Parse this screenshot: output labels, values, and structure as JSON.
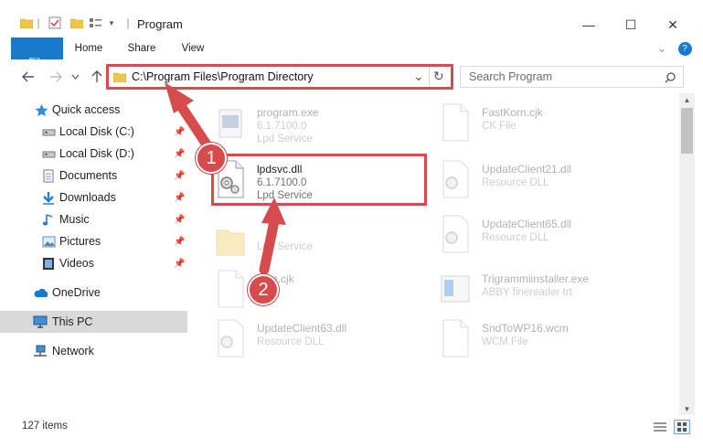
{
  "window": {
    "title": "Program",
    "minimize_glyph": "—",
    "maximize_glyph": "☐",
    "close_glyph": "✕"
  },
  "ribbon": {
    "tabs": [
      "File",
      "Home",
      "Share",
      "View"
    ],
    "expand_glyph": "⌄",
    "help_glyph": "?"
  },
  "address_bar": {
    "path": "C:\\Program Files\\Program Directory",
    "dropdown_glyph": "⌄",
    "refresh_glyph": "↻"
  },
  "search": {
    "placeholder": "Search Program",
    "icon": "search-icon"
  },
  "sidebar": {
    "quick_access": "Quick access",
    "items": [
      {
        "label": "Local Disk (C:)",
        "icon": "drive-icon",
        "pinned": true
      },
      {
        "label": "Local Disk (D:)",
        "icon": "drive-icon",
        "pinned": true
      },
      {
        "label": "Documents",
        "icon": "documents-icon",
        "pinned": true
      },
      {
        "label": "Downloads",
        "icon": "download-icon",
        "pinned": true
      },
      {
        "label": "Music",
        "icon": "music-icon",
        "pinned": true
      },
      {
        "label": "Pictures",
        "icon": "pictures-icon",
        "pinned": true
      },
      {
        "label": "Videos",
        "icon": "videos-icon",
        "pinned": true
      }
    ],
    "onedrive": "OneDrive",
    "this_pc": "This PC",
    "network": "Network"
  },
  "files": {
    "left": [
      {
        "name": "program.exe",
        "line1": "6.1.7100.0",
        "line2": "Lpd Service",
        "faded": true
      },
      {
        "name": "lpdsvc.dll",
        "line1": "6.1.7100.0",
        "line2": "Lpd Service",
        "faded": false,
        "highlighted": true
      },
      {
        "name": "",
        "line1": "",
        "line2": "Lpd Service",
        "faded": true
      },
      {
        "name": "lean.cjk",
        "line1": "",
        "line2": "",
        "faded": true
      },
      {
        "name": "UpdateClient63.dll",
        "line1": "Resource DLL",
        "line2": "",
        "faded": true
      }
    ],
    "right": [
      {
        "name": "FastKorn.cjk",
        "line1": "CK File",
        "faded": true
      },
      {
        "name": "UpdateClient21.dll",
        "line1": "Resource DLL",
        "faded": true
      },
      {
        "name": "UpdateClient65.dll",
        "line1": "Resource DLL",
        "faded": true
      },
      {
        "name": "Trigrammiinstaller.exe",
        "line1": "ABBY finereader trt",
        "faded": true
      },
      {
        "name": "SndToWP16.wcm",
        "line1": "WCM File",
        "faded": true
      }
    ]
  },
  "status": {
    "item_count": "127 items"
  },
  "callouts": [
    "1",
    "2"
  ],
  "colors": {
    "accent": "#1979ca",
    "highlight": "#d64b4b",
    "selected": "#d9d9d9"
  }
}
